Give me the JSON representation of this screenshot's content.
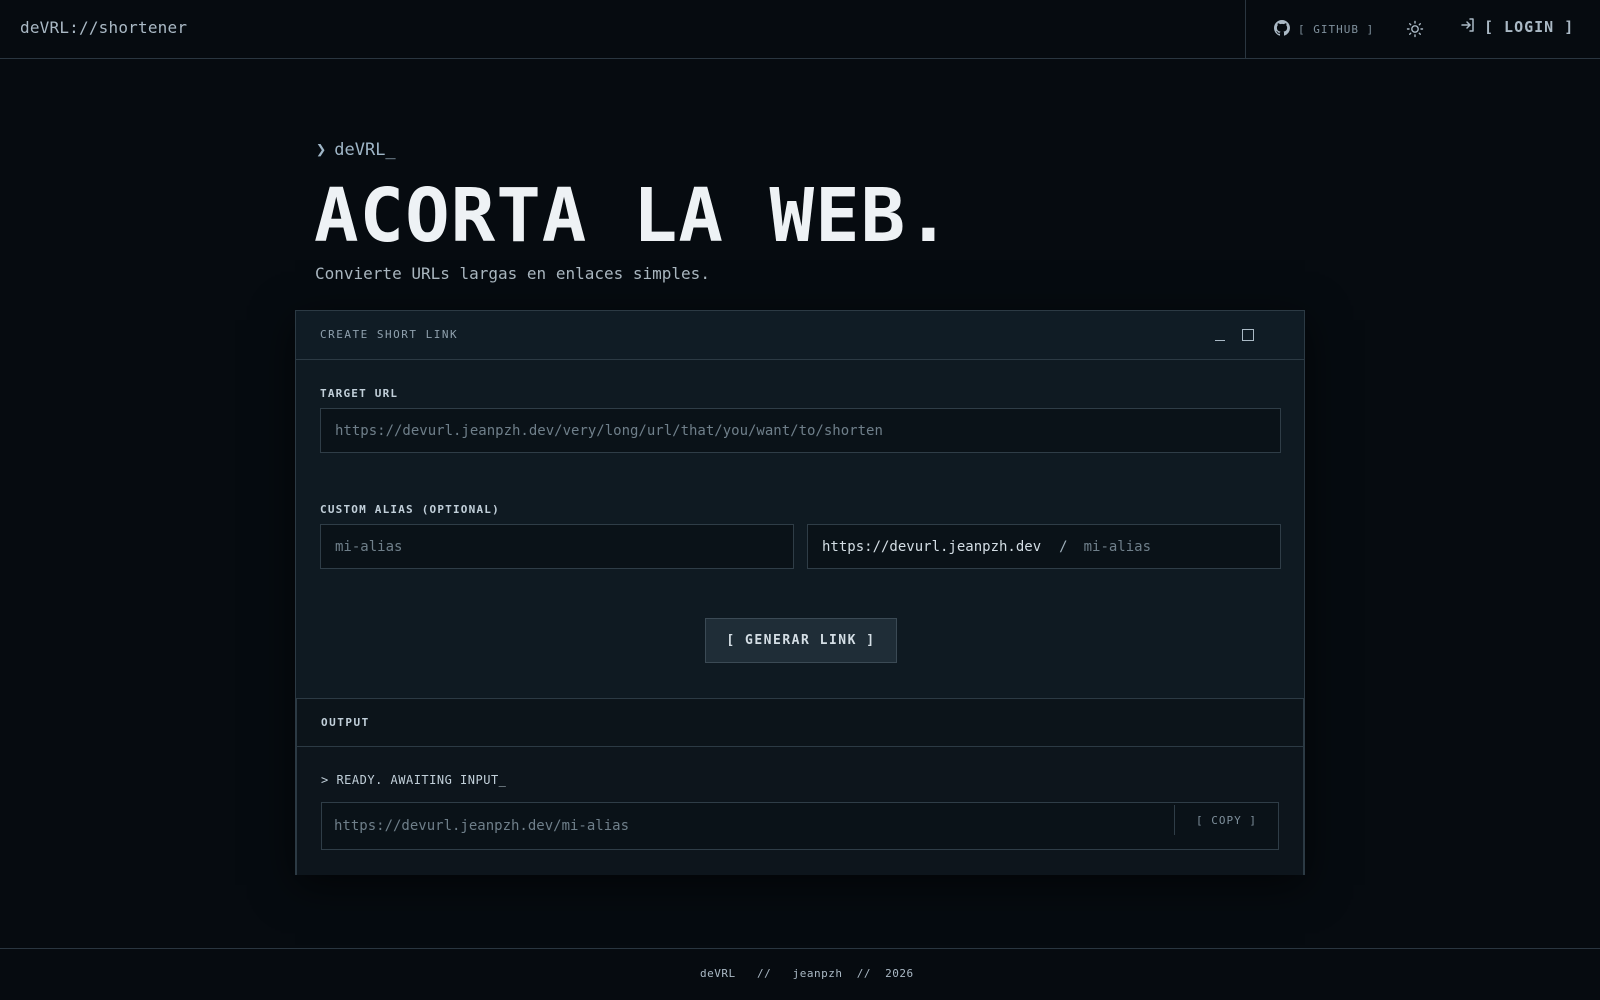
{
  "header": {
    "brand": "deVRL://shortener",
    "github_label": "[ GITHUB ]",
    "login_label": "[ LOGIN ]"
  },
  "hero": {
    "prompt": "deVRL_",
    "title": "ACORTA LA WEB.",
    "subtitle": "Convierte URLs largas en enlaces simples."
  },
  "card": {
    "title": "CREATE SHORT LINK",
    "target_label": "TARGET URL",
    "target_placeholder": "https://devurl.jeanpzh.dev/very/long/url/that/you/want/to/shorten",
    "alias_label": "CUSTOM ALIAS (OPTIONAL)",
    "alias_placeholder": "mi-alias",
    "preview_host": "https://devurl.jeanpzh.dev",
    "preview_sep": "/",
    "preview_alias": "mi-alias",
    "generate_label": "[ GENERAR LINK ]"
  },
  "output": {
    "title": "OUTPUT",
    "status": "> READY. AWAITING INPUT_",
    "url_placeholder": "https://devurl.jeanpzh.dev/mi-alias",
    "copy_label": "[ COPY ]"
  },
  "footer": {
    "text": "deVRL   //   jeanpzh  //  2026"
  },
  "colors": {
    "background": "#060b10",
    "card": "#0f1a22",
    "border": "#2c3a44",
    "accent": "#9fb6c7"
  }
}
